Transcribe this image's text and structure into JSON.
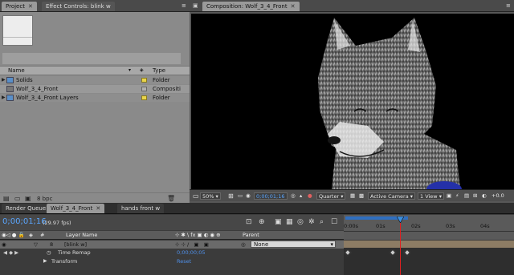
{
  "project_panel": {
    "tabs": [
      {
        "label": "Project"
      },
      {
        "label": "Effect Controls: blink w"
      }
    ],
    "columns": {
      "name": "Name",
      "type": "Type"
    },
    "items": [
      {
        "name": "Solids",
        "type": "Folder",
        "icon": "folder-icon"
      },
      {
        "name": "Wolf_3_4_Front",
        "type": "Compositi",
        "icon": "composition-icon"
      },
      {
        "name": "Wolf_3_4_Front Layers",
        "type": "Folder",
        "icon": "folder-icon"
      }
    ],
    "bit_depth": "8 bpc",
    "label_color": "#e9d44a"
  },
  "composition_panel": {
    "tab": "Composition: Wolf_3_4_Front",
    "zoom": "50%",
    "timecode": "0;00;01;16",
    "resolution": "Quarter",
    "camera": "Active Camera",
    "views": "1 View",
    "exposure": "+0.0"
  },
  "timeline_panel": {
    "tabs": [
      {
        "label": "Render Queue"
      },
      {
        "label": "Wolf_3_4_Front"
      },
      {
        "label": "hands front w"
      }
    ],
    "current_time": "0;00;01;16",
    "fps": "(29.97 fps)",
    "columns": {
      "layer_name": "Layer Name",
      "parent": "Parent",
      "label_col": "#"
    },
    "layer": {
      "index": "8",
      "name": "[blink w]",
      "parent": "None"
    },
    "properties": [
      {
        "name": "Time Remap",
        "value": "0;00;00;05"
      },
      {
        "name": "Transform",
        "value": "Reset"
      }
    ],
    "ruler_ticks": [
      "0:00s",
      "01s",
      "02s",
      "03s",
      "04s"
    ],
    "accent_color": "#5aa6ff",
    "playhead_color": "#e02020"
  }
}
